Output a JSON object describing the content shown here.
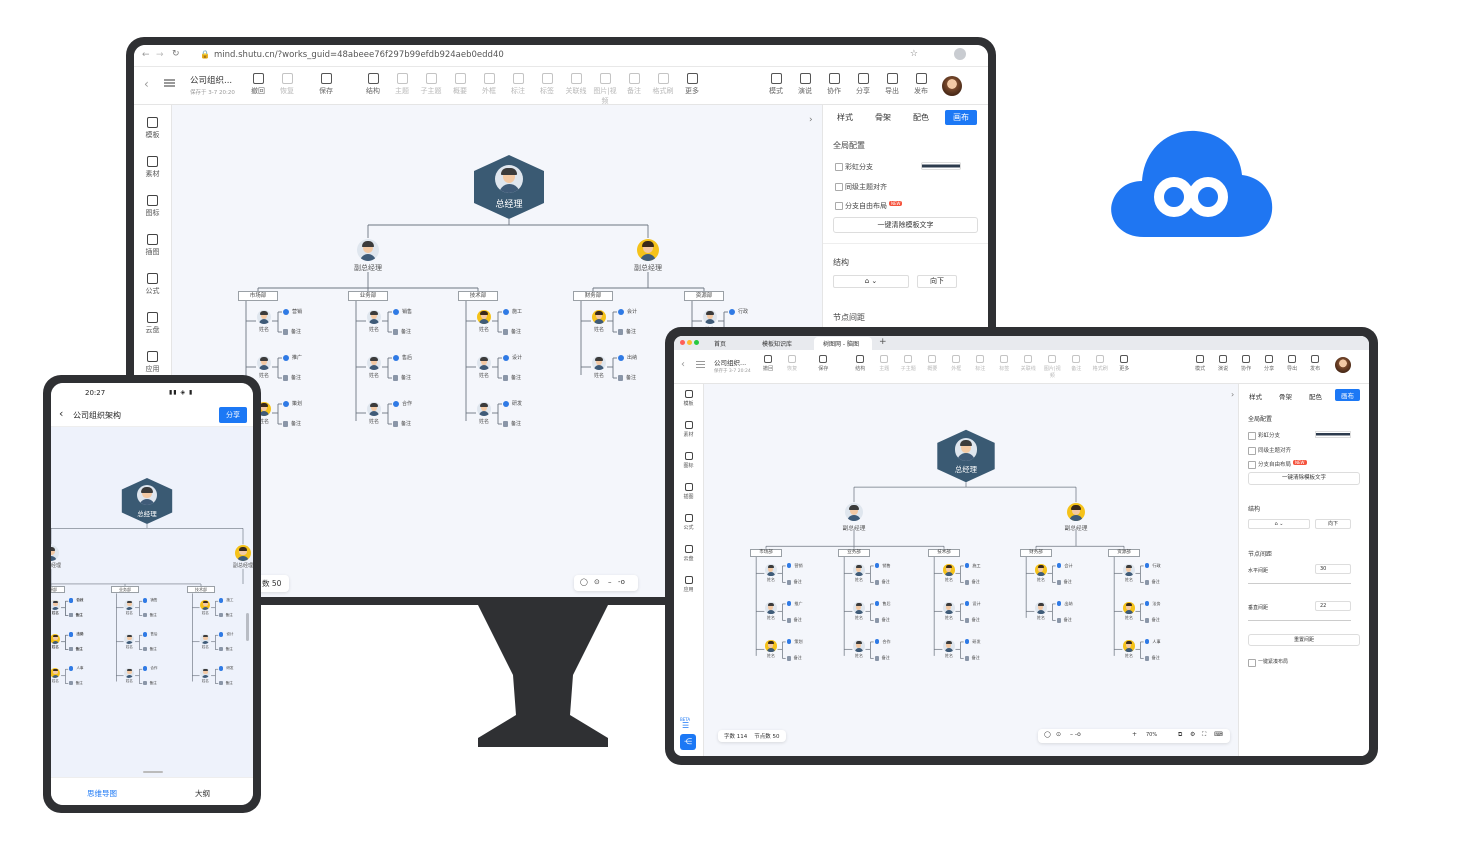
{
  "desktop": {
    "url": "mind.shutu.cn/?works_guid=48abeee76f297b99efdb924aeb0edd40",
    "doc_title": "公司组织...",
    "saved_at": "保存于 3-7 20:20",
    "toolbar": [
      {
        "label": "撤回",
        "icon": "undo-icon",
        "enabled": true
      },
      {
        "label": "恢复",
        "icon": "redo-icon",
        "enabled": false
      },
      {
        "label": "保存",
        "icon": "save-icon",
        "enabled": true
      },
      {
        "label": "结构",
        "icon": "structure-icon",
        "enabled": true
      },
      {
        "label": "主题",
        "icon": "topic-icon",
        "enabled": false
      },
      {
        "label": "子主题",
        "icon": "subtopic-icon",
        "enabled": false
      },
      {
        "label": "概要",
        "icon": "summary-icon",
        "enabled": false
      },
      {
        "label": "外框",
        "icon": "frame-icon",
        "enabled": false
      },
      {
        "label": "标注",
        "icon": "callout-icon",
        "enabled": false
      },
      {
        "label": "标签",
        "icon": "tag-icon",
        "enabled": false
      },
      {
        "label": "关联线",
        "icon": "relation-icon",
        "enabled": false
      },
      {
        "label": "图片|视频",
        "icon": "media-icon",
        "enabled": false
      },
      {
        "label": "备注",
        "icon": "note-icon",
        "enabled": false
      },
      {
        "label": "格式刷",
        "icon": "brush-icon",
        "enabled": false
      },
      {
        "label": "更多",
        "icon": "more-icon",
        "enabled": true
      }
    ],
    "toolbar_right": [
      {
        "label": "模式",
        "icon": "mode-icon"
      },
      {
        "label": "演说",
        "icon": "present-icon",
        "badge": "BETA"
      },
      {
        "label": "协作",
        "icon": "collab-icon"
      },
      {
        "label": "分享",
        "icon": "share-icon"
      },
      {
        "label": "导出",
        "icon": "export-icon"
      },
      {
        "label": "发布",
        "icon": "publish-icon"
      }
    ],
    "sidebar": [
      {
        "label": "模板",
        "icon": "template-icon"
      },
      {
        "label": "素材",
        "icon": "material-icon"
      },
      {
        "label": "图标",
        "icon": "icons-icon"
      },
      {
        "label": "插图",
        "icon": "illustration-icon"
      },
      {
        "label": "公式",
        "icon": "formula-icon"
      },
      {
        "label": "云盘",
        "icon": "cloud-disk-icon"
      },
      {
        "label": "应用",
        "icon": "apps-icon"
      }
    ],
    "panel": {
      "tabs": [
        "样式",
        "骨架",
        "配色",
        "画布"
      ],
      "active_tab": "画布",
      "global_title": "全局配置",
      "rainbow": "彩虹分支",
      "align": "同级主题对齐",
      "free_layout": "分支自由布局",
      "new_badge": "NEW",
      "clear_btn": "一键清除模板文字",
      "structure_title": "结构",
      "direction": "向下",
      "spacing_title": "节点间距"
    },
    "node_count": "数 50"
  },
  "mindmap": {
    "root": "总经理",
    "vp1": "副总经理",
    "vp2": "副总经理",
    "name": "姓名",
    "depts": [
      "市场部",
      "业务部",
      "技术部",
      "财务部",
      "资源部"
    ],
    "groups": [
      [
        "营销",
        "推广",
        "策划"
      ],
      [
        "销售",
        "售后",
        "合作"
      ],
      [
        "施工",
        "设计",
        "研发"
      ],
      [
        "会计",
        "出纳"
      ],
      [
        "行政",
        "法务",
        "人事"
      ]
    ],
    "note": "备注"
  },
  "tablet": {
    "tabs": [
      "首页",
      "模板知识库",
      "树图网 - 脑图"
    ],
    "doc_title": "公司组织...",
    "saved_at": "保存于 3-7 20:24",
    "h_spacing_label": "水平间距",
    "h_spacing": "30",
    "v_spacing_label": "垂直间距",
    "v_spacing": "22",
    "reset_btn": "重置间距",
    "compact": "一键紧凑布局",
    "beta": "BETA",
    "word_count": "字数 114",
    "node_count": "节点数 50",
    "zoom": "70%"
  },
  "phone": {
    "time": "20:27",
    "title": "公司组织架构",
    "share_btn": "分享",
    "tab_mindmap": "思维导图",
    "tab_outline": "大纲"
  },
  "colors": {
    "accent": "#1c78f5",
    "cloud": "#1f76f2",
    "node": "#3a5a73",
    "bezel": "#2f3033"
  }
}
